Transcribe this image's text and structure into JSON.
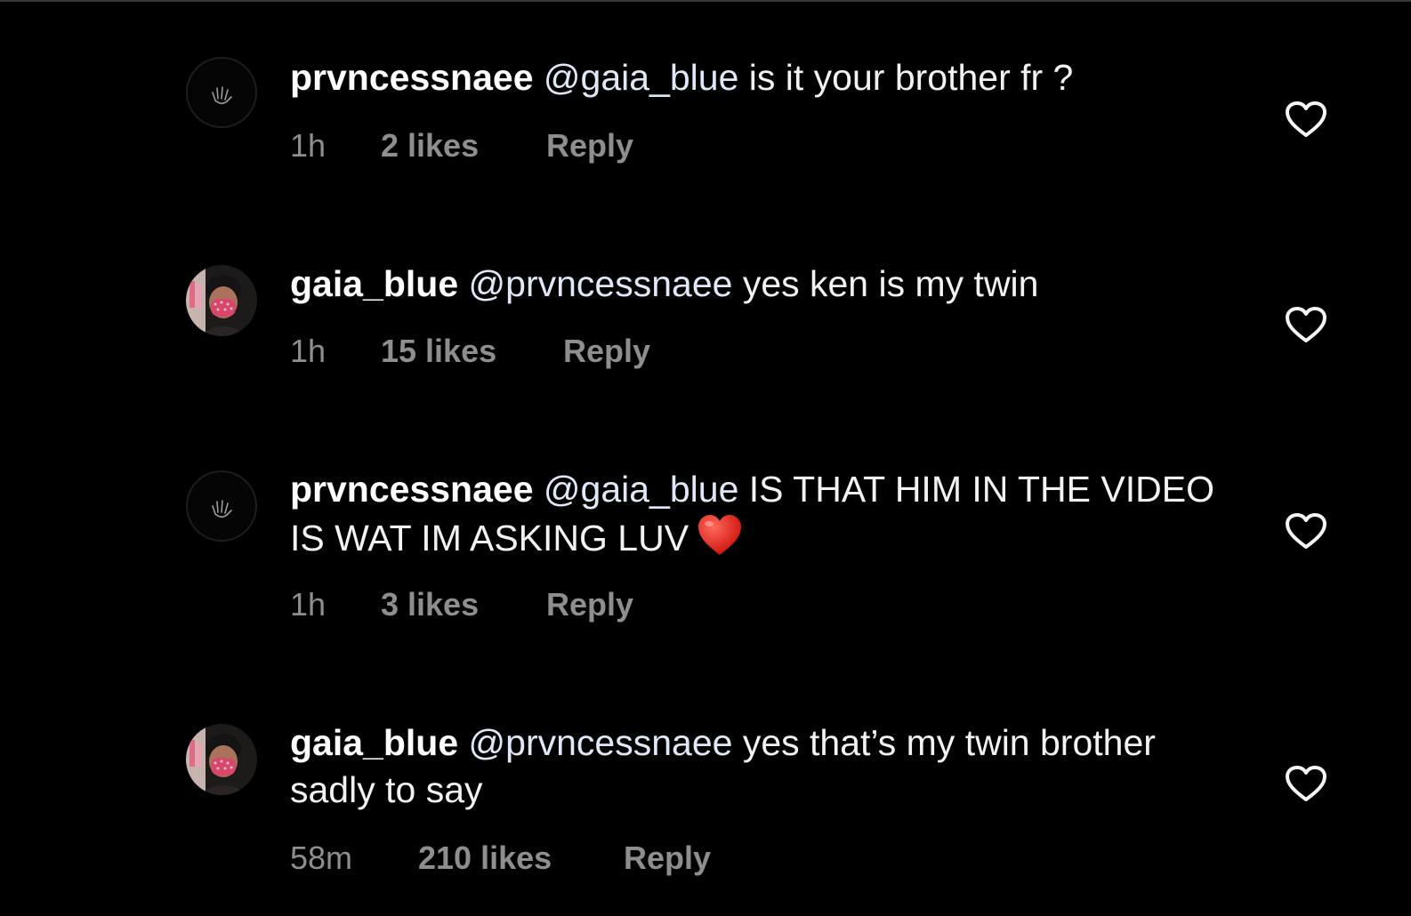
{
  "comments": [
    {
      "username": "prvncessnaee",
      "mention": "@gaia_blue",
      "text": " is it your brother fr ?",
      "time": "1h",
      "likes": "2 likes",
      "reply": "Reply",
      "avatar": "dark-hand-avatar",
      "emoji": ""
    },
    {
      "username": "gaia_blue",
      "mention": "@prvncessnaee",
      "text": " yes ken is my twin",
      "time": "1h",
      "likes": "15 likes",
      "reply": "Reply",
      "avatar": "masked-person-avatar",
      "emoji": ""
    },
    {
      "username": "prvncessnaee",
      "mention": "@gaia_blue",
      "text": " IS THAT HIM IN THE VIDEO IS WAT IM ASKING LUV",
      "time": "1h",
      "likes": "3 likes",
      "reply": "Reply",
      "avatar": "dark-hand-avatar",
      "emoji": "red-heart-emoji"
    },
    {
      "username": "gaia_blue",
      "mention": "@prvncessnaee",
      "text": " yes that’s my twin brother sadly to say",
      "time": "58m",
      "likes": "210 likes",
      "reply": "Reply",
      "avatar": "masked-person-avatar",
      "emoji": ""
    }
  ],
  "colors": {
    "background": "#000000",
    "text": "#f2f2f2",
    "meta": "#8e8e8e",
    "emoji_heart": "#e8201c"
  }
}
